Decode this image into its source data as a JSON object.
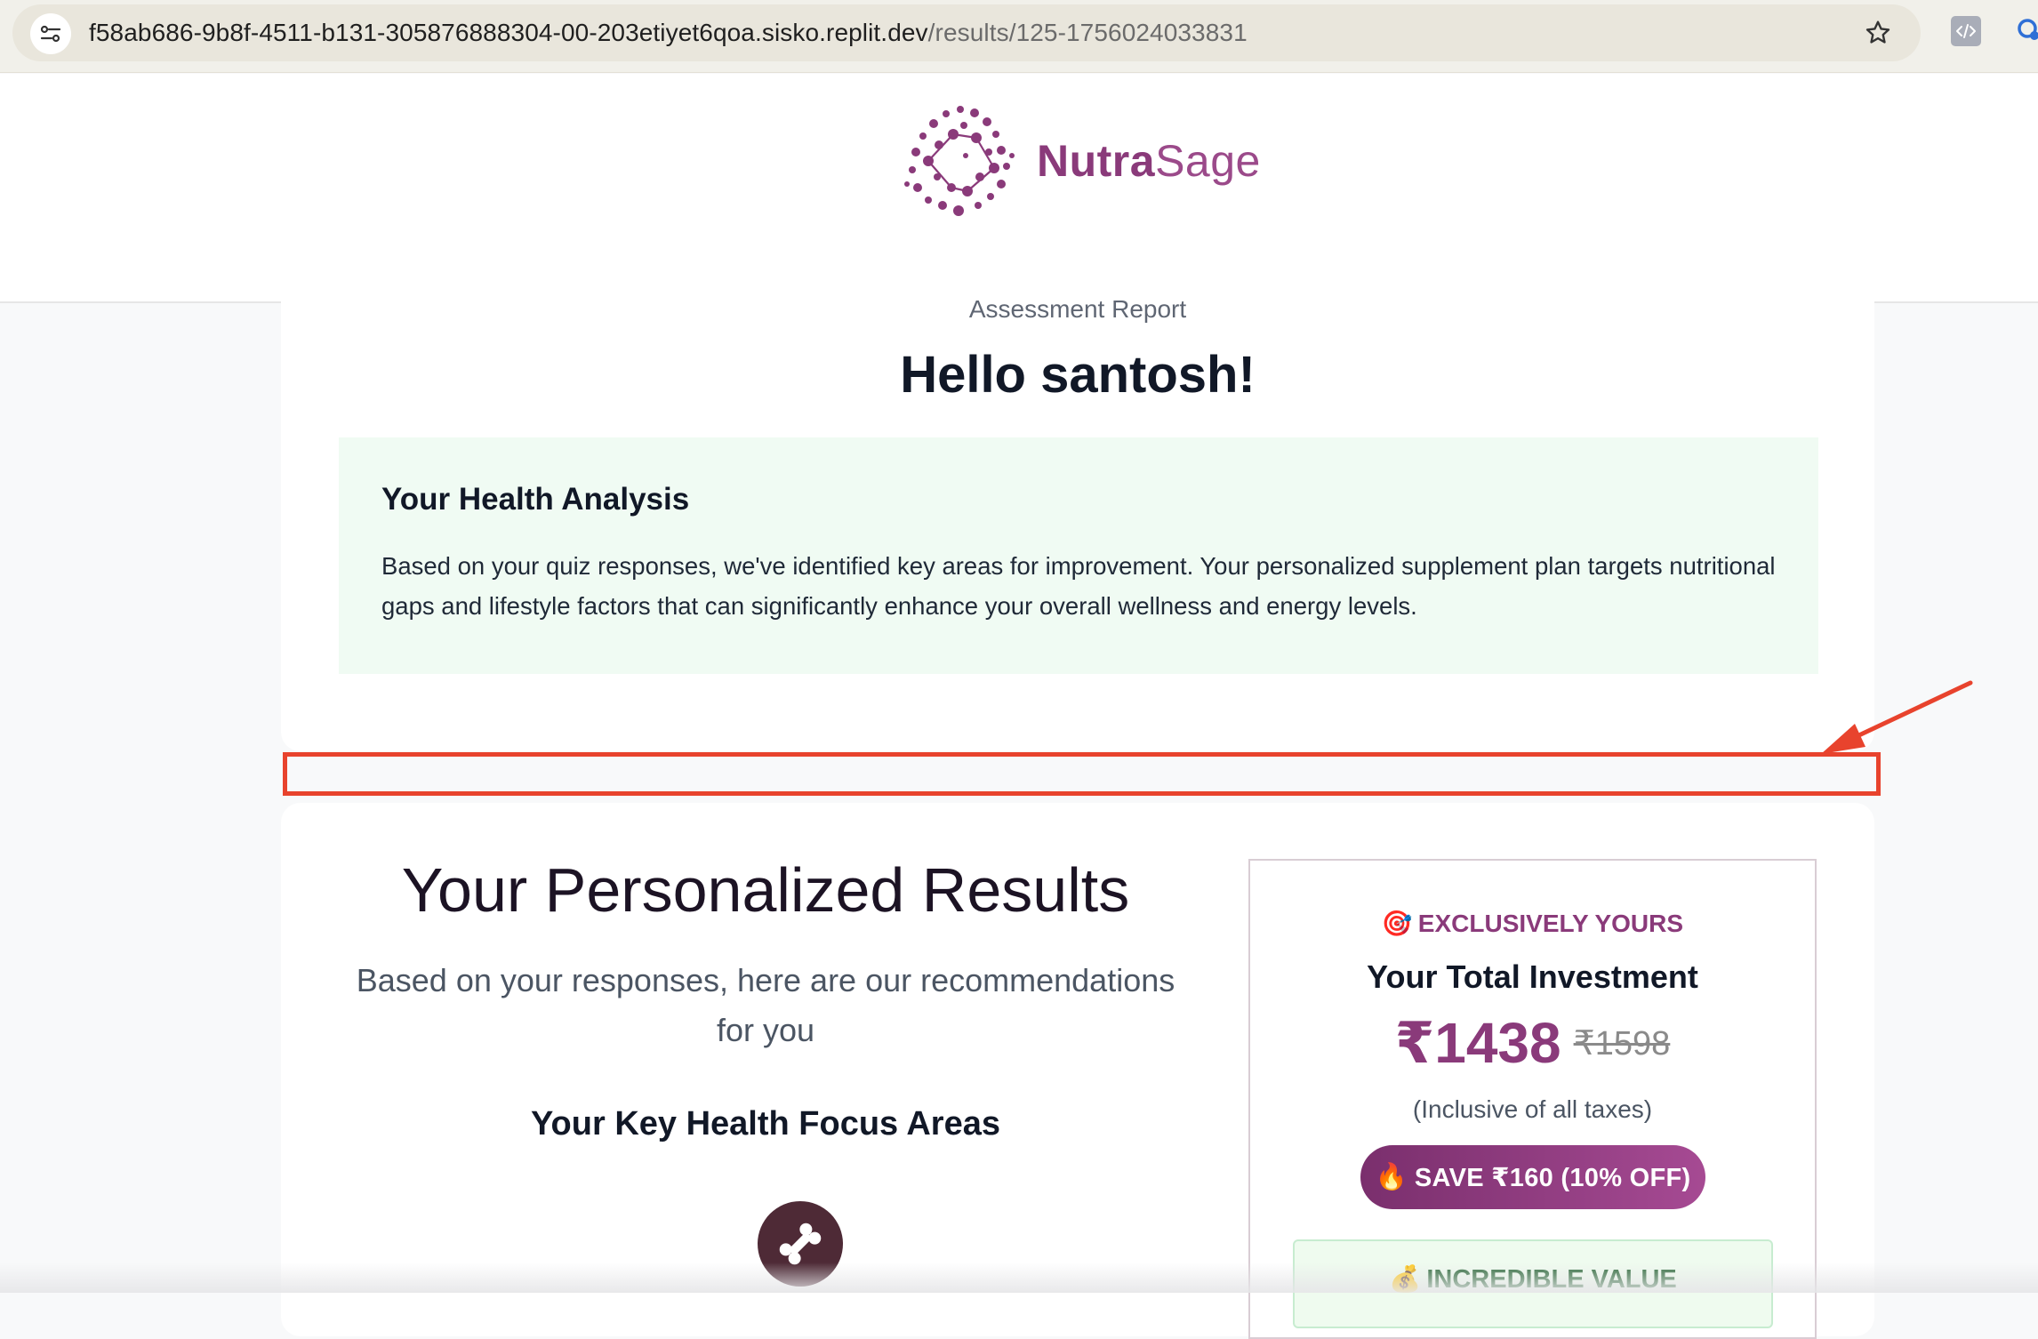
{
  "browser": {
    "url_host": "f58ab686-9b8f-4511-b131-305876888304-00-203etiyet6qoa.sisko.replit.dev",
    "url_path": "/results/125-1756024033831",
    "icons": [
      "site-settings-icon",
      "bookmark-star-icon",
      "devtools-extension-icon",
      "extension-icon"
    ]
  },
  "header": {
    "logo_bold": "Nutra",
    "logo_light": "Sage",
    "logo_icon": "molecule-dots-logo"
  },
  "report": {
    "label": "Assessment Report",
    "greeting": "Hello santosh!",
    "analysis_title": "Your Health Analysis",
    "analysis_body": "Based on your quiz responses, we've identified key areas for improvement. Your personalized supplement plan targets nutritional gaps and lifestyle factors that can significantly enhance your overall wellness and energy levels."
  },
  "results": {
    "title": "Your Personalized Results",
    "subtitle": "Based on your responses, here are our recommendations for you",
    "focus_title": "Your Key Health Focus Areas",
    "focus_icon": "bone-icon"
  },
  "pricing": {
    "exclusive_emoji": "🎯",
    "exclusive_label": "EXCLUSIVELY YOURS",
    "title": "Your Total Investment",
    "price_now": "₹1438",
    "price_was": "₹1598",
    "tax_note": "(Inclusive of all taxes)",
    "save_emoji": "🔥",
    "save_label": "SAVE ₹160 (10% OFF)",
    "value_emoji": "💰",
    "value_label": "INCREDIBLE VALUE"
  },
  "colors": {
    "brand": "#8a3a7a",
    "annotation": "#e8432d",
    "analysis_bg": "#f0fbf3",
    "focus_icon_bg": "#4e2a36"
  }
}
